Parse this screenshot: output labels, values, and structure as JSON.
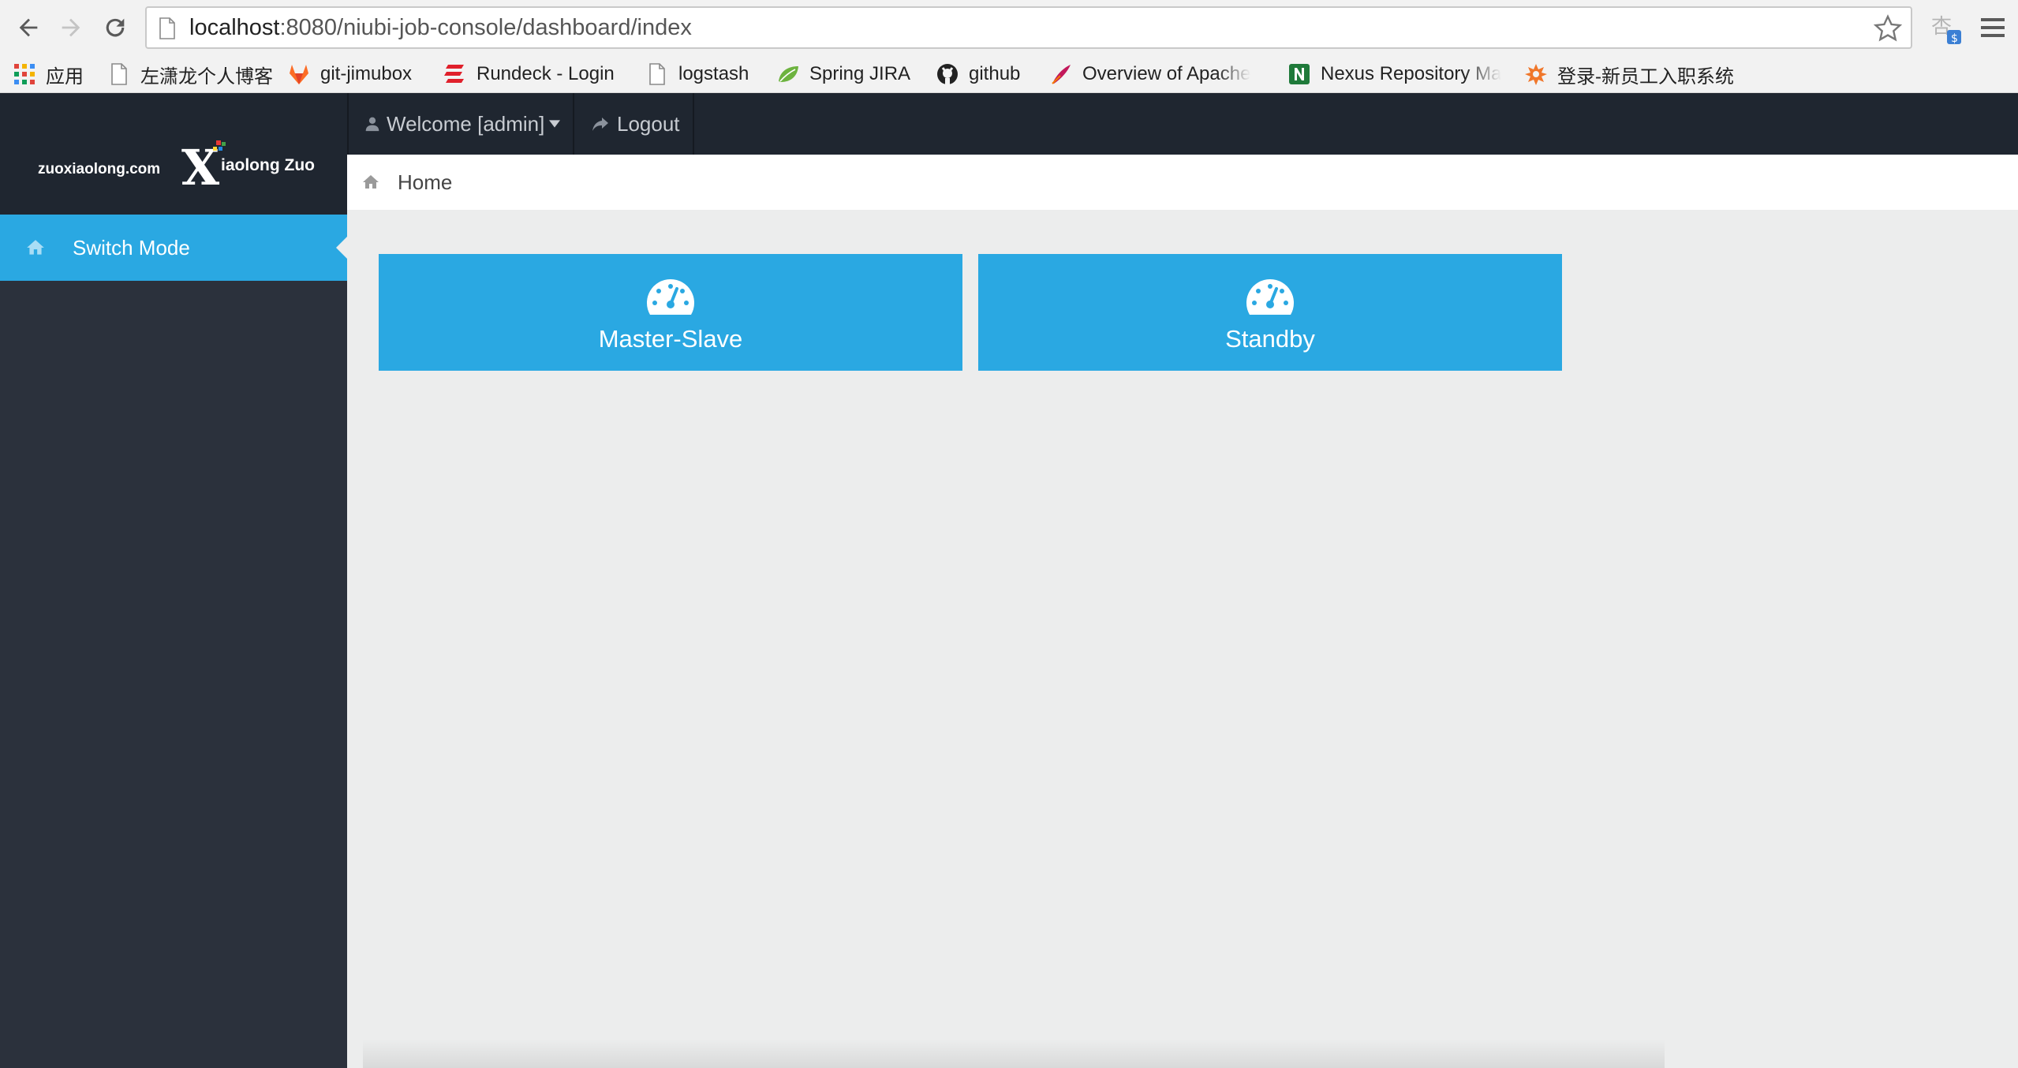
{
  "browser": {
    "url_host": "localhost",
    "url_rest": ":8080/niubi-job-console/dashboard/index",
    "bookmarks": [
      {
        "label": "应用",
        "icon": "apps-grid-icon"
      },
      {
        "label": "左潇龙个人博客",
        "icon": "page-icon"
      },
      {
        "label": "git-jimubox",
        "icon": "gitlab-icon"
      },
      {
        "label": "Rundeck - Login",
        "icon": "rundeck-icon"
      },
      {
        "label": "logstash",
        "icon": "page-icon"
      },
      {
        "label": "Spring JIRA",
        "icon": "spring-leaf-icon"
      },
      {
        "label": "github",
        "icon": "github-icon"
      },
      {
        "label": "Overview of Apache",
        "icon": "apache-feather-icon"
      },
      {
        "label": "Nexus Repository Ma",
        "icon": "nexus-icon"
      },
      {
        "label": "登录-新员工入职系统",
        "icon": "star-burst-icon"
      }
    ]
  },
  "sidebar": {
    "logo_site": "zuoxiaolong.com",
    "logo_mark": "X",
    "logo_name": "iaolong Zuo",
    "items": [
      {
        "label": "Switch Mode",
        "icon": "home-icon",
        "active": true
      }
    ]
  },
  "topbar": {
    "welcome_label": "Welcome [admin]",
    "logout_label": "Logout"
  },
  "breadcrumb": {
    "label": "Home"
  },
  "tiles": [
    {
      "label": "Master-Slave",
      "icon": "dashboard-gauge-icon"
    },
    {
      "label": "Standby",
      "icon": "dashboard-gauge-icon"
    }
  ],
  "colors": {
    "accent": "#2aa8e2",
    "sidebar_bg": "#2b313c",
    "topbar_bg": "#1f2630",
    "content_bg": "#eceded"
  }
}
